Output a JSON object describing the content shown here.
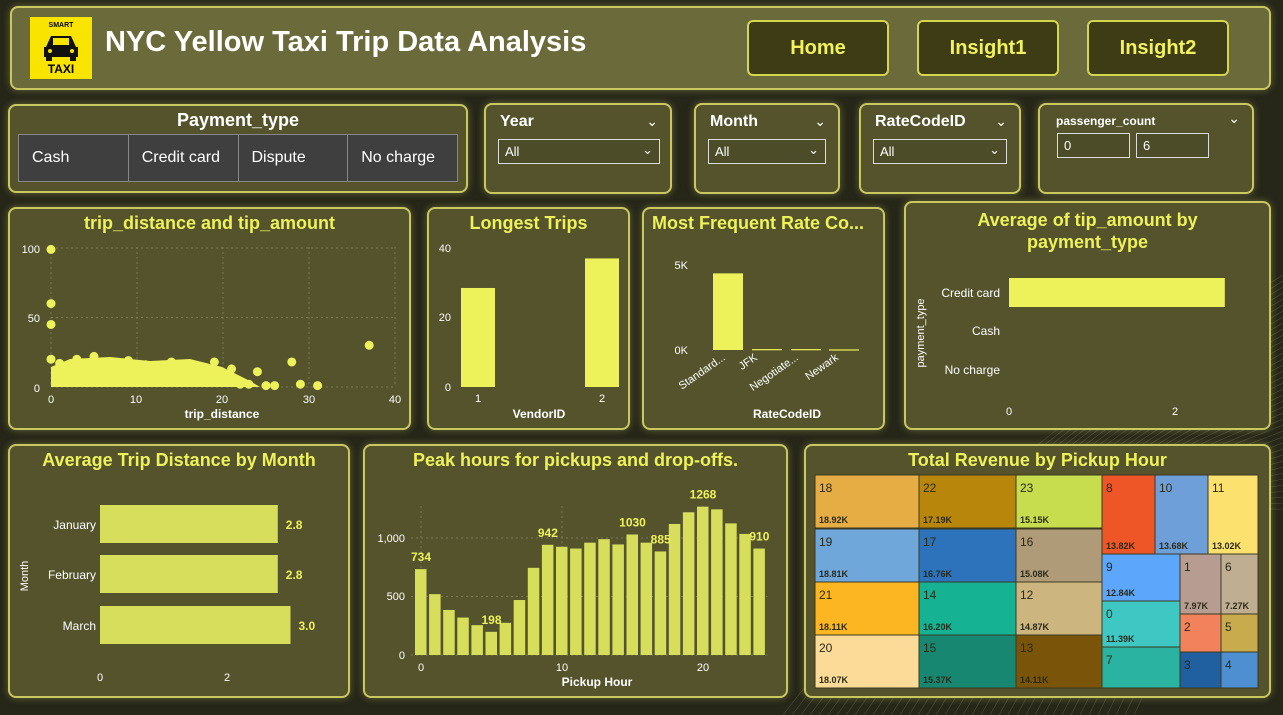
{
  "header": {
    "logo_line1": "SMART",
    "logo_line2": "TAXI",
    "title": "NYC Yellow Taxi Trip Data Analysis",
    "nav": [
      {
        "label": "Home"
      },
      {
        "label": "Insight1"
      },
      {
        "label": "Insight2"
      }
    ]
  },
  "filters": {
    "payment": {
      "label": "Payment_type",
      "options": [
        "Cash",
        "Credit card",
        "Dispute",
        "No charge"
      ]
    },
    "year": {
      "label": "Year",
      "value": "All"
    },
    "month": {
      "label": "Month",
      "value": "All"
    },
    "ratecode": {
      "label": "RateCodeID",
      "value": "All"
    },
    "passenger": {
      "label": "passenger_count",
      "min": "0",
      "max": "6"
    }
  },
  "charts": {
    "scatter": {
      "title": "trip_distance and tip_amount",
      "xlabel": "trip_distance",
      "xticks": [
        "0",
        "10",
        "20",
        "30",
        "40"
      ],
      "yticks": [
        "0",
        "50",
        "100"
      ]
    },
    "longest": {
      "title": "Longest Trips",
      "xlabel": "VendorID",
      "yticks": [
        "0",
        "20",
        "40"
      ],
      "xticks": [
        "1",
        "2"
      ]
    },
    "ratecode": {
      "title": "Most Frequent Rate Co...",
      "xlabel": "RateCodeID",
      "yticks": [
        "0K",
        "5K"
      ],
      "xticks": [
        "Standard...",
        "JFK",
        "Negotiate...",
        "Newark"
      ]
    },
    "tip": {
      "title_line1": "Average of tip_amount by",
      "title_line2": "payment_type",
      "ylabel": "payment_type",
      "xticks": [
        "0",
        "2"
      ],
      "cats": [
        "Credit card",
        "Cash",
        "No charge"
      ]
    },
    "month": {
      "title": "Average Trip Distance by Month",
      "ylabel": "Month",
      "xticks": [
        "0",
        "2"
      ]
    },
    "peak": {
      "title": "Peak hours for pickups and drop-offs.",
      "xlabel": "Pickup Hour",
      "yticks": [
        "0",
        "500",
        "1,000"
      ],
      "xticks": [
        "0",
        "10",
        "20"
      ]
    },
    "treemap": {
      "title": "Total Revenue by Pickup Hour"
    }
  },
  "chart_data": [
    {
      "type": "scatter",
      "title": "trip_distance and tip_amount",
      "xlabel": "trip_distance",
      "ylabel": "",
      "xlim": [
        0,
        40
      ],
      "ylim": [
        0,
        100
      ],
      "points": [
        [
          0,
          99
        ],
        [
          0,
          60
        ],
        [
          0,
          45
        ],
        [
          0,
          20
        ],
        [
          1,
          17
        ],
        [
          2,
          12
        ],
        [
          3,
          20
        ],
        [
          4,
          15
        ],
        [
          5,
          22
        ],
        [
          6,
          17
        ],
        [
          7,
          12
        ],
        [
          8,
          14
        ],
        [
          9,
          19
        ],
        [
          10,
          10
        ],
        [
          11,
          16
        ],
        [
          12,
          8
        ],
        [
          13,
          13
        ],
        [
          14,
          18
        ],
        [
          15,
          11
        ],
        [
          16,
          15
        ],
        [
          17,
          9
        ],
        [
          18,
          7
        ],
        [
          19,
          18
        ],
        [
          20,
          5
        ],
        [
          21,
          13
        ],
        [
          22,
          2
        ],
        [
          23,
          2
        ],
        [
          24,
          11
        ],
        [
          25,
          1
        ],
        [
          26,
          1
        ],
        [
          28,
          18
        ],
        [
          29,
          2
        ],
        [
          31,
          1
        ],
        [
          37,
          30
        ]
      ]
    },
    {
      "type": "bar",
      "title": "Longest Trips",
      "xlabel": "VendorID",
      "categories": [
        "1",
        "2"
      ],
      "values": [
        28.5,
        37
      ],
      "ylim": [
        0,
        40
      ]
    },
    {
      "type": "bar",
      "title": "Most Frequent Rate Co...",
      "xlabel": "RateCodeID",
      "categories": [
        "Standard...",
        "JFK",
        "Negotiate...",
        "Newark"
      ],
      "values": [
        4900,
        60,
        60,
        40
      ],
      "ylim": [
        0,
        5500
      ]
    },
    {
      "type": "bar",
      "orientation": "horizontal",
      "title": "Average of tip_amount by payment_type",
      "ylabel": "payment_type",
      "categories": [
        "Credit card",
        "Cash",
        "No charge"
      ],
      "values": [
        2.6,
        0,
        0
      ],
      "xlim": [
        0,
        3
      ]
    },
    {
      "type": "bar",
      "orientation": "horizontal",
      "title": "Average Trip Distance by Month",
      "ylabel": "Month",
      "categories": [
        "January",
        "February",
        "March"
      ],
      "values": [
        2.8,
        2.8,
        3.0
      ],
      "labels": [
        "2.8",
        "2.8",
        "3.0"
      ],
      "xlim": [
        0,
        3.2
      ]
    },
    {
      "type": "bar",
      "title": "Peak hours for pickups and drop-offs.",
      "xlabel": "Pickup Hour",
      "x": [
        0,
        1,
        2,
        3,
        4,
        5,
        6,
        7,
        8,
        9,
        10,
        11,
        12,
        13,
        14,
        15,
        16,
        17,
        18,
        19,
        20,
        21,
        22,
        23
      ],
      "values": [
        734,
        520,
        385,
        320,
        255,
        198,
        275,
        470,
        745,
        942,
        925,
        910,
        960,
        990,
        945,
        1030,
        960,
        885,
        1120,
        1220,
        1268,
        1245,
        1125,
        1035,
        910
      ],
      "labels": {
        "0": "734",
        "5": "198",
        "9": "942",
        "15": "1030",
        "17": "885",
        "20": "1268",
        "24": "910"
      },
      "ylim": [
        0,
        1400
      ]
    },
    {
      "type": "treemap",
      "title": "Total Revenue by Pickup Hour",
      "cells": [
        {
          "label": "18",
          "value": "18.92K",
          "color": "#e6ad45"
        },
        {
          "label": "19",
          "value": "18.81K",
          "color": "#6fa7db"
        },
        {
          "label": "21",
          "value": "18.11K",
          "color": "#fbb621"
        },
        {
          "label": "20",
          "value": "18.07K",
          "color": "#fbdb97"
        },
        {
          "label": "22",
          "value": "17.19K",
          "color": "#b8860b"
        },
        {
          "label": "17",
          "value": "16.76K",
          "color": "#2c73bb"
        },
        {
          "label": "14",
          "value": "16.20K",
          "color": "#15b294"
        },
        {
          "label": "15",
          "value": "15.37K",
          "color": "#178772"
        },
        {
          "label": "23",
          "value": "15.15K",
          "color": "#c7dd4e"
        },
        {
          "label": "16",
          "value": "15.08K",
          "color": "#b09b78"
        },
        {
          "label": "12",
          "value": "14.87K",
          "color": "#cdb580"
        },
        {
          "label": "13",
          "value": "14.11K",
          "color": "#7a5409"
        },
        {
          "label": "8",
          "value": "13.82K",
          "color": "#ee5627"
        },
        {
          "label": "10",
          "value": "13.68K",
          "color": "#6e9fd9"
        },
        {
          "label": "11",
          "value": "13.02K",
          "color": "#fde16f"
        },
        {
          "label": "9",
          "value": "12.84K",
          "color": "#5ca7fb"
        },
        {
          "label": "0",
          "value": "11.39K",
          "color": "#3fc8c3"
        },
        {
          "label": "7",
          "value": "",
          "color": "#2ab3a1"
        },
        {
          "label": "1",
          "value": "7.97K",
          "color": "#b79c91"
        },
        {
          "label": "6",
          "value": "7.27K",
          "color": "#bfae92"
        },
        {
          "label": "2",
          "value": "",
          "color": "#f2825c"
        },
        {
          "label": "5",
          "value": "",
          "color": "#c8ab4c"
        },
        {
          "label": "3",
          "value": "",
          "color": "#2060a0"
        },
        {
          "label": "4",
          "value": "",
          "color": "#4e8fd1"
        }
      ]
    }
  ]
}
